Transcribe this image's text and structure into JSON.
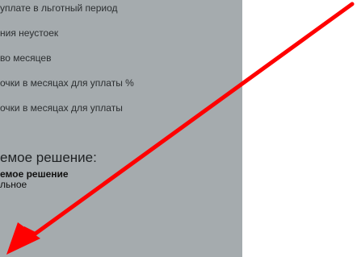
{
  "panel": {
    "items": [
      "уплате в льготный период",
      "ния неустоек",
      "во месяцев",
      "очки в месяцах для уплаты %",
      "очки в месяцах для уплаты"
    ],
    "decision_title": "емое решение:",
    "decision_label": "емое решение",
    "decision_value": "льное"
  },
  "colors": {
    "panel_bg": "#a5abae",
    "arrow": "#ff0000"
  }
}
